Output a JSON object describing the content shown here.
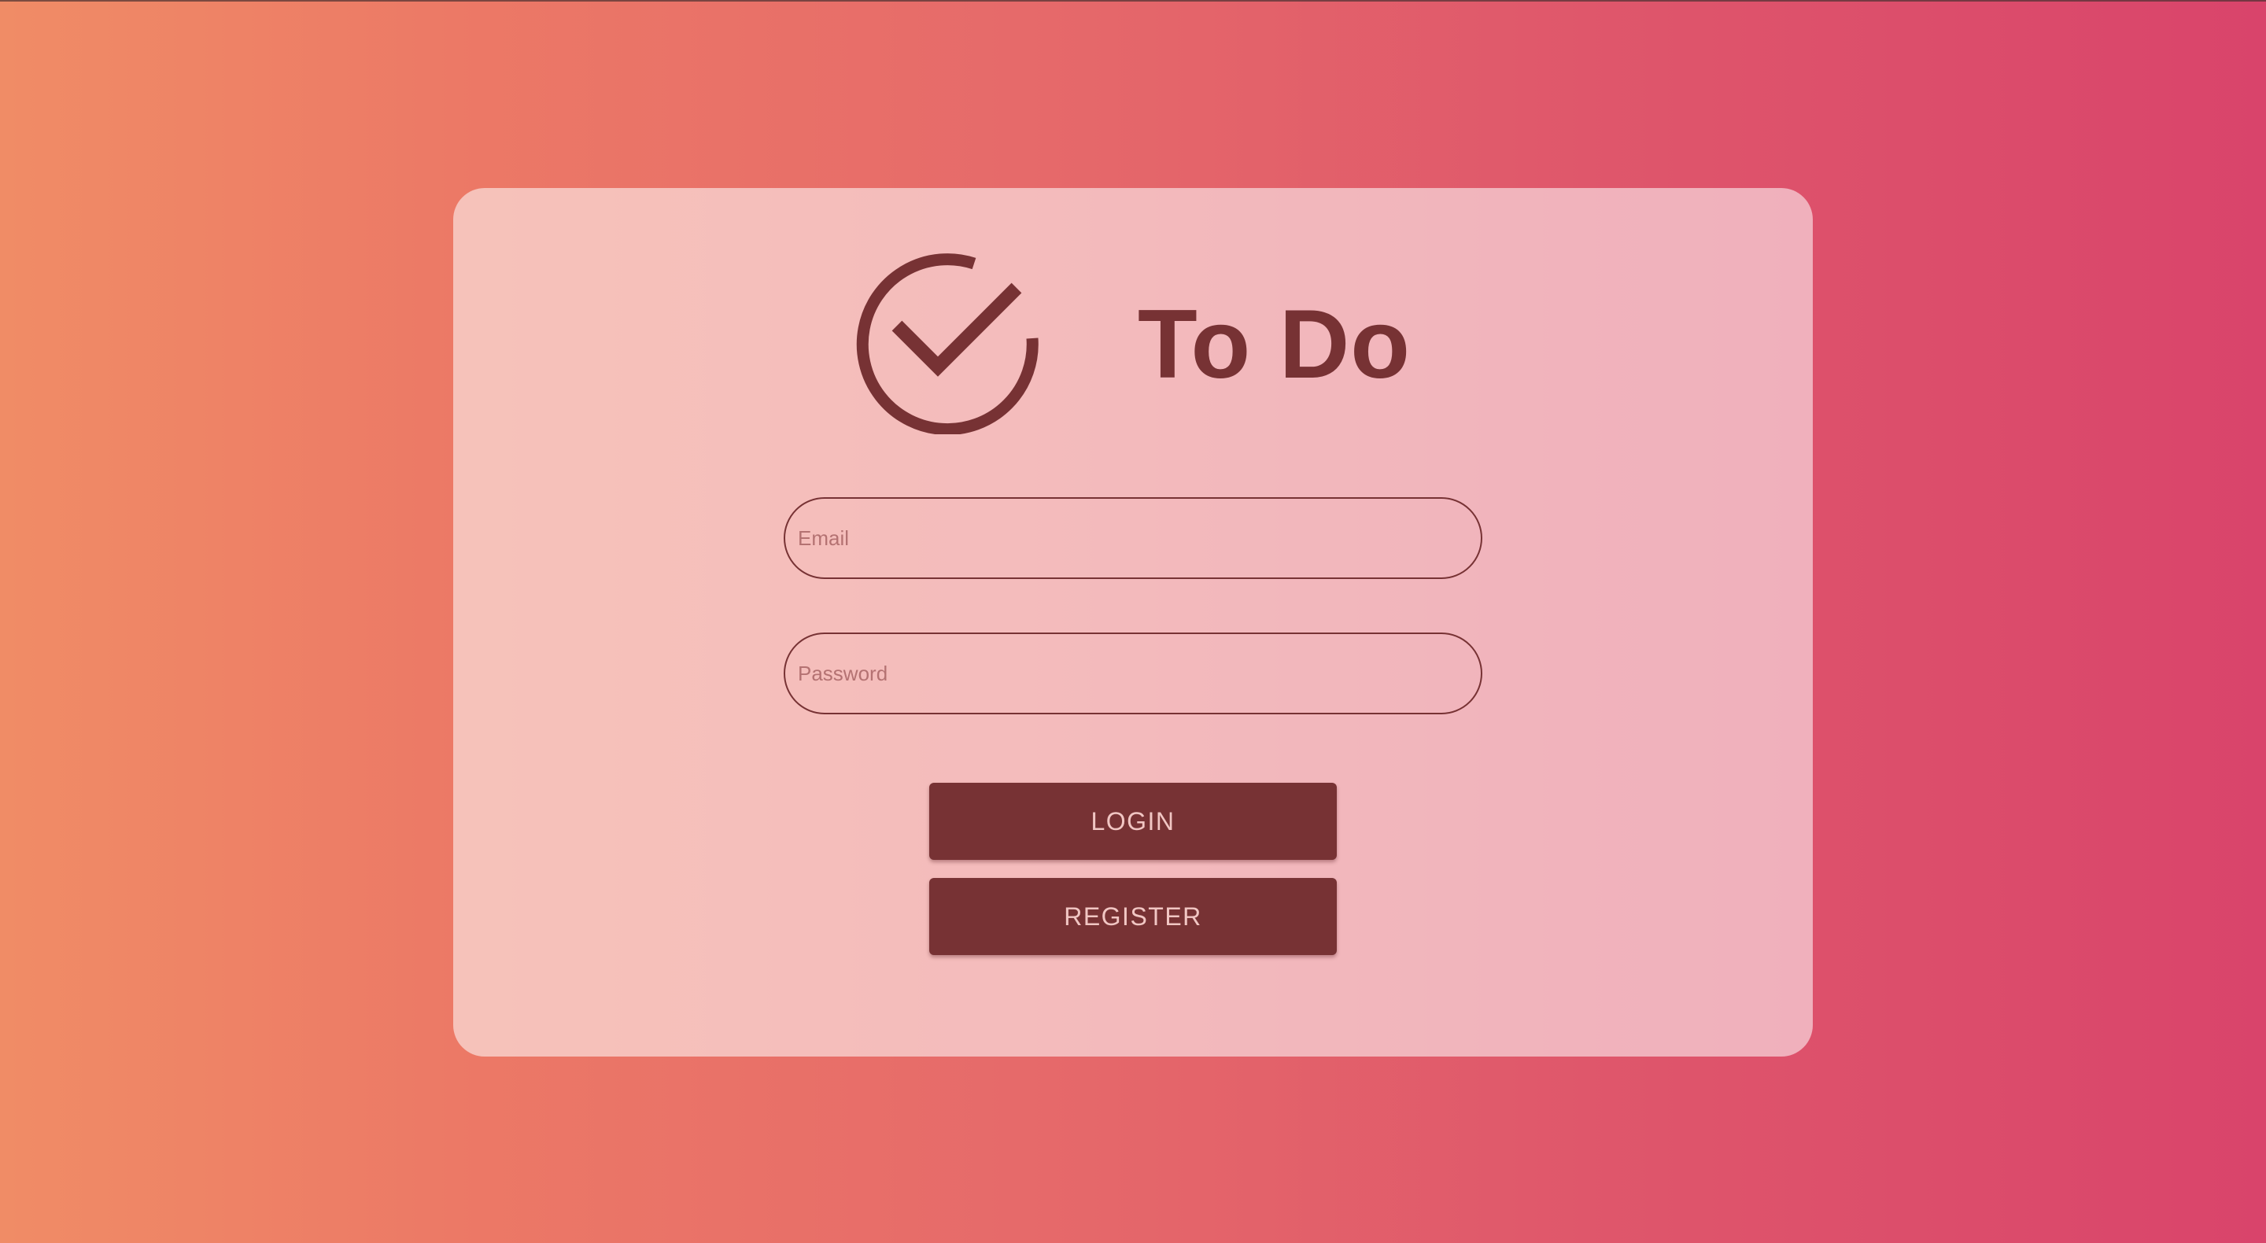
{
  "app": {
    "title": "To Do",
    "logo_icon": "check-circle-icon"
  },
  "form": {
    "email": {
      "placeholder": "Email",
      "value": ""
    },
    "password": {
      "placeholder": "Password",
      "value": ""
    },
    "login_label": "LOGIN",
    "register_label": "REGISTER"
  },
  "colors": {
    "accent": "#773234",
    "button_text": "#f1c6c3",
    "background_start": "#f08c66",
    "background_end": "#d9446b"
  }
}
